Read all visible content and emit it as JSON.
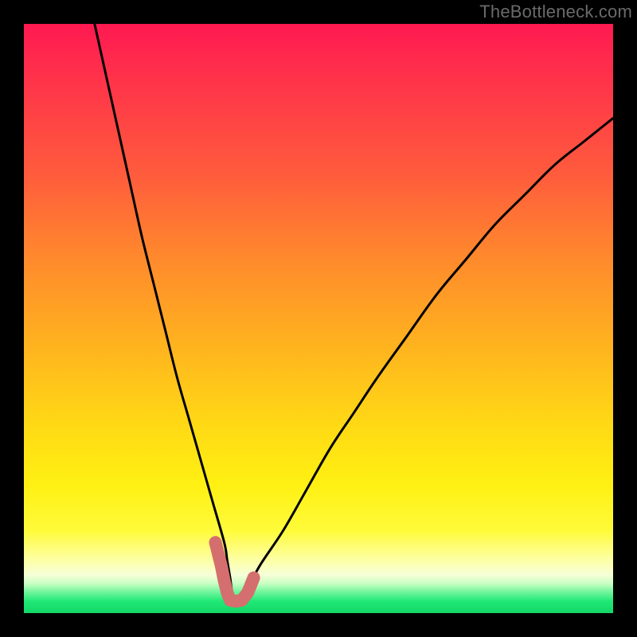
{
  "watermark": "TheBottleneck.com",
  "chart_data": {
    "type": "line",
    "title": "",
    "xlabel": "",
    "ylabel": "",
    "xlim": [
      0,
      100
    ],
    "ylim": [
      0,
      100
    ],
    "series": [
      {
        "name": "curve",
        "color": "#000000",
        "x": [
          12,
          14,
          16,
          18,
          20,
          22,
          24,
          26,
          28,
          30,
          32,
          34,
          34.5,
          35,
          35.5,
          36.5,
          37,
          38,
          40,
          44,
          48,
          52,
          56,
          60,
          65,
          70,
          75,
          80,
          85,
          90,
          95,
          100
        ],
        "y": [
          100,
          91,
          82,
          73,
          64,
          56,
          48,
          40,
          33,
          26,
          19,
          12,
          9,
          6,
          3,
          2,
          2,
          4,
          8,
          14,
          21,
          28,
          34,
          40,
          47,
          54,
          60,
          66,
          71,
          76,
          80,
          84
        ]
      },
      {
        "name": "bottom-marker",
        "color": "#d56e6e",
        "x": [
          32.5,
          33.5,
          34.0,
          34.5,
          35.0,
          36.0,
          37.0,
          38.0,
          39.0
        ],
        "y": [
          12.0,
          8.0,
          5.5,
          3.5,
          2.2,
          2.0,
          2.2,
          3.5,
          6.0
        ]
      }
    ],
    "annotations": [
      {
        "text": "TheBottleneck.com",
        "position": "top-right"
      }
    ]
  }
}
